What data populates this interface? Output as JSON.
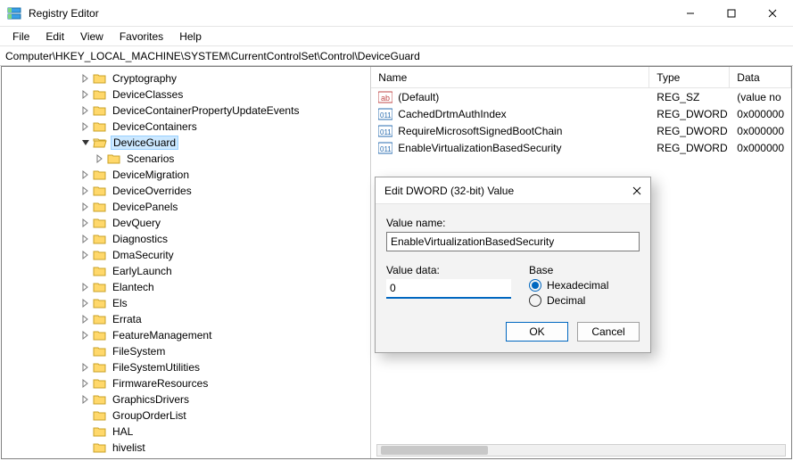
{
  "window": {
    "title": "Registry Editor"
  },
  "menu": {
    "file": "File",
    "edit": "Edit",
    "view": "View",
    "favorites": "Favorites",
    "help": "Help"
  },
  "address": "Computer\\HKEY_LOCAL_MACHINE\\SYSTEM\\CurrentControlSet\\Control\\DeviceGuard",
  "tree": {
    "items": [
      {
        "indent": 5,
        "label": "Cryptography",
        "twisty": "right",
        "open": false
      },
      {
        "indent": 5,
        "label": "DeviceClasses",
        "twisty": "right",
        "open": false
      },
      {
        "indent": 5,
        "label": "DeviceContainerPropertyUpdateEvents",
        "twisty": "right",
        "open": false
      },
      {
        "indent": 5,
        "label": "DeviceContainers",
        "twisty": "right",
        "open": false
      },
      {
        "indent": 5,
        "label": "DeviceGuard",
        "twisty": "down",
        "open": true,
        "selected": true
      },
      {
        "indent": 6,
        "label": "Scenarios",
        "twisty": "right",
        "open": false
      },
      {
        "indent": 5,
        "label": "DeviceMigration",
        "twisty": "right",
        "open": false
      },
      {
        "indent": 5,
        "label": "DeviceOverrides",
        "twisty": "right",
        "open": false
      },
      {
        "indent": 5,
        "label": "DevicePanels",
        "twisty": "right",
        "open": false
      },
      {
        "indent": 5,
        "label": "DevQuery",
        "twisty": "right",
        "open": false
      },
      {
        "indent": 5,
        "label": "Diagnostics",
        "twisty": "right",
        "open": false
      },
      {
        "indent": 5,
        "label": "DmaSecurity",
        "twisty": "right",
        "open": false
      },
      {
        "indent": 5,
        "label": "EarlyLaunch",
        "twisty": "none",
        "open": false
      },
      {
        "indent": 5,
        "label": "Elantech",
        "twisty": "right",
        "open": false
      },
      {
        "indent": 5,
        "label": "Els",
        "twisty": "right",
        "open": false
      },
      {
        "indent": 5,
        "label": "Errata",
        "twisty": "right",
        "open": false
      },
      {
        "indent": 5,
        "label": "FeatureManagement",
        "twisty": "right",
        "open": false
      },
      {
        "indent": 5,
        "label": "FileSystem",
        "twisty": "none",
        "open": false
      },
      {
        "indent": 5,
        "label": "FileSystemUtilities",
        "twisty": "right",
        "open": false
      },
      {
        "indent": 5,
        "label": "FirmwareResources",
        "twisty": "right",
        "open": false
      },
      {
        "indent": 5,
        "label": "GraphicsDrivers",
        "twisty": "right",
        "open": false
      },
      {
        "indent": 5,
        "label": "GroupOrderList",
        "twisty": "none",
        "open": false
      },
      {
        "indent": 5,
        "label": "HAL",
        "twisty": "none",
        "open": false
      },
      {
        "indent": 5,
        "label": "hivelist",
        "twisty": "none",
        "open": false
      }
    ]
  },
  "list": {
    "columns": {
      "name": "Name",
      "type": "Type",
      "data": "Data"
    },
    "rows": [
      {
        "icon": "string",
        "name": "(Default)",
        "type": "REG_SZ",
        "data": "(value no"
      },
      {
        "icon": "dword",
        "name": "CachedDrtmAuthIndex",
        "type": "REG_DWORD",
        "data": "0x000000"
      },
      {
        "icon": "dword",
        "name": "RequireMicrosoftSignedBootChain",
        "type": "REG_DWORD",
        "data": "0x000000"
      },
      {
        "icon": "dword",
        "name": "EnableVirtualizationBasedSecurity",
        "type": "REG_DWORD",
        "data": "0x000000"
      }
    ]
  },
  "dialog": {
    "title": "Edit DWORD (32-bit) Value",
    "value_name_label": "Value name:",
    "value_name": "EnableVirtualizationBasedSecurity",
    "value_data_label": "Value data:",
    "value_data": "0",
    "base_label": "Base",
    "hex_label": "Hexadecimal",
    "dec_label": "Decimal",
    "base_selected": "hex",
    "ok": "OK",
    "cancel": "Cancel"
  }
}
